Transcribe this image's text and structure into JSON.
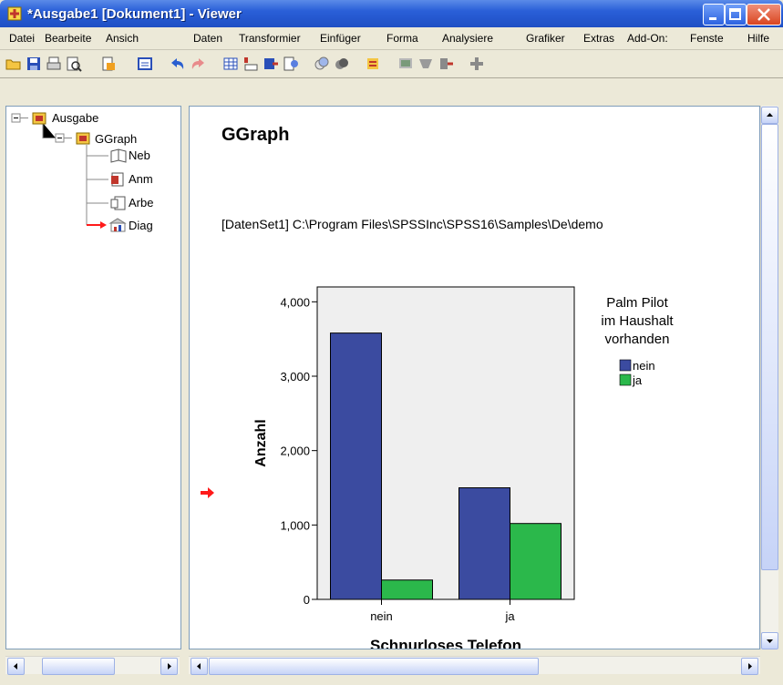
{
  "window": {
    "title": "*Ausgabe1 [Dokument1] - Viewer"
  },
  "menu": [
    "Datei",
    "Bearbeite",
    "Ansich",
    "Daten",
    "Transformier",
    "Einfüger",
    "Forma",
    "Analysiere",
    "Grafiker",
    "Extras",
    "Add-On:",
    "Fenste",
    "Hilfe"
  ],
  "tree": {
    "root": "Ausgabe",
    "child": "GGraph",
    "leaves": [
      "Neb",
      "Anm",
      "Arbe",
      "Diag"
    ]
  },
  "output": {
    "heading": "GGraph",
    "dataset_line": "[DatenSet1]  C:\\Program  Files\\SPSSInc\\SPSS16\\Samples\\De\\demo"
  },
  "icons": {
    "app": "spss-viewer-icon",
    "toolbar": [
      "open-folder-icon",
      "save-icon",
      "print-icon",
      "print-preview-icon",
      "export-icon",
      "insert-output-icon",
      "undo-icon",
      "redo-icon",
      "data-editor-icon",
      "goto-data-icon",
      "goto-case-icon",
      "variables-icon",
      "select-icon",
      "show-icon",
      "insert-heading-icon",
      "insert-text-icon",
      "insert-title-icon",
      "demote-icon",
      "promote-icon"
    ]
  },
  "colors": {
    "nein": "#3b4ba0",
    "ja": "#2bb84b",
    "plot_bg": "#efefef",
    "marker": "#ff1a1a"
  },
  "chart_data": {
    "type": "bar",
    "xlabel": "Schnurloses Telefon",
    "ylabel": "Anzahl",
    "categories": [
      "nein",
      "ja"
    ],
    "series": [
      {
        "name": "nein",
        "values": [
          3580,
          1500
        ]
      },
      {
        "name": "ja",
        "values": [
          260,
          1020
        ]
      }
    ],
    "ylim": [
      0,
      4200
    ],
    "yticks": [
      0,
      1000,
      2000,
      3000,
      4000
    ],
    "ytick_labels": [
      "0",
      "1,000",
      "2,000",
      "3,000",
      "4,000"
    ],
    "legend_title": "Palm Pilot im Haushalt vorhanden",
    "legend_title_lines": [
      "Palm Pilot",
      "im Haushalt",
      "vorhanden"
    ],
    "legend_placement": "right",
    "grid": false
  }
}
